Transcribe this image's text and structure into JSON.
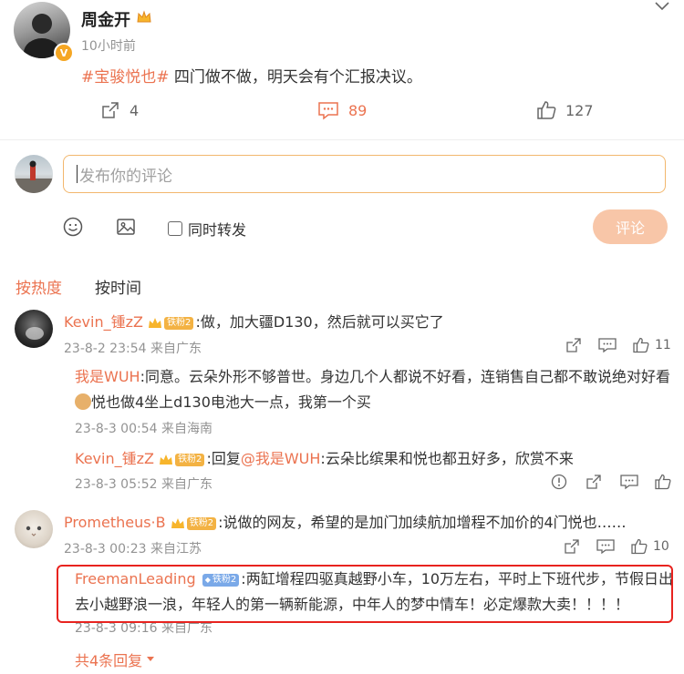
{
  "post": {
    "author": "周金开",
    "time": "10小时前",
    "topic": "#宝骏悦也#",
    "text": " 四门做不做，明天会有个汇报决议。",
    "repost_count": "4",
    "comment_count": "89",
    "like_count": "127"
  },
  "composer": {
    "placeholder": "发布你的评论",
    "repost_label": "同时转发",
    "submit_label": "评论"
  },
  "sort": {
    "hot_label": "按热度",
    "time_label": "按时间"
  },
  "comments": [
    {
      "user": "Kevin_锺zZ",
      "fan_badge": "铁粉2",
      "text": ":做，加大疆D130，然后就可以买它了",
      "meta": "23-8-2 23:54 来自广东",
      "like_count": "11",
      "replies": [
        {
          "user": "我是WUH",
          "text_line1": ":同意。云朵外形不够普世。身边几个人都说不好看，连销售自己都不敢说绝对好看",
          "text_line2": "悦也做4坐上d130电池大一点，我第一个买",
          "meta": "23-8-3 00:54 来自海南"
        },
        {
          "user": "Kevin_锺zZ",
          "fan_badge": "铁粉2",
          "prefix": ":回复",
          "mention": "@我是WUH",
          "text": ":云朵比缤果和悦也都丑好多，欣赏不来",
          "meta": "23-8-3 05:52 来自广东"
        }
      ]
    },
    {
      "user": "Prometheus·B",
      "fan_badge": "铁粉2",
      "text": ":说做的网友，希望的是加门加续航加增程不加价的4门悦也……",
      "meta": "23-8-3 00:23 来自江苏",
      "like_count": "10",
      "replies": [
        {
          "user": "FreemanLeading",
          "fan_badge": "铁粉2",
          "text_line1": ":两缸增程四驱真越野小车，10万左右，平时上下班代步，节假日出",
          "text_line2": "去小越野浪一浪，年轻人的第一辆新能源，中年人的梦中情车！必定爆款大卖！！！！",
          "meta": "23-8-3 09:16 来自广东"
        }
      ],
      "more_replies": "共4条回复"
    }
  ],
  "colors": {
    "accent": "#eb7350",
    "meta_gray": "#939393",
    "highlight_box": "#e8231f",
    "submit_bg": "#f8c6a8"
  }
}
